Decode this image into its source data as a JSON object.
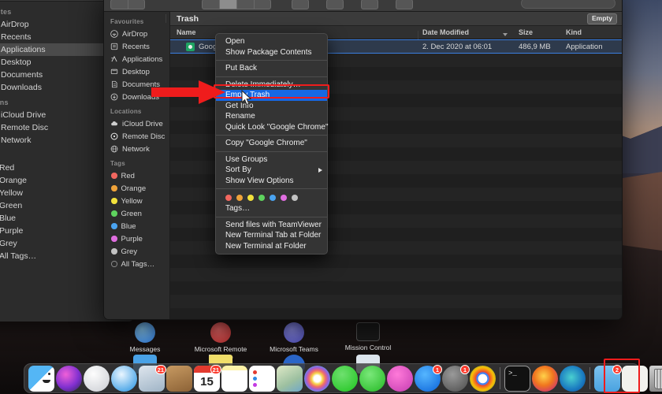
{
  "back_window": {
    "sections": [
      {
        "header": "ourites",
        "items": [
          {
            "label": "AirDrop",
            "icon": "airdrop-icon",
            "selected": false
          },
          {
            "label": "Recents",
            "icon": "recents-icon",
            "selected": false
          },
          {
            "label": "Applications",
            "icon": "applications-icon",
            "selected": true
          },
          {
            "label": "Desktop",
            "icon": "desktop-icon",
            "selected": false
          },
          {
            "label": "Documents",
            "icon": "documents-icon",
            "selected": false
          },
          {
            "label": "Downloads",
            "icon": "downloads-icon",
            "selected": false
          }
        ]
      },
      {
        "header": "ations",
        "items": [
          {
            "label": "iCloud Drive",
            "icon": "icloud-icon",
            "selected": false
          },
          {
            "label": "Remote Disc",
            "icon": "disc-icon",
            "selected": false
          },
          {
            "label": "Network",
            "icon": "network-icon",
            "selected": false
          }
        ]
      },
      {
        "header": "s",
        "items": [
          {
            "label": "Red",
            "icon": "tag-dot-icon",
            "color": "#f2675f"
          },
          {
            "label": "Orange",
            "icon": "tag-dot-icon",
            "color": "#f0a33a"
          },
          {
            "label": "Yellow",
            "icon": "tag-dot-icon",
            "color": "#f2e13c"
          },
          {
            "label": "Green",
            "icon": "tag-dot-icon",
            "color": "#5ed35e"
          },
          {
            "label": "Blue",
            "icon": "tag-dot-icon",
            "color": "#4aa3f0"
          },
          {
            "label": "Purple",
            "icon": "tag-dot-icon",
            "color": "#e06ee0"
          },
          {
            "label": "Grey",
            "icon": "tag-dot-icon",
            "color": "#c3c3c3"
          },
          {
            "label": "All Tags…",
            "icon": "all-tags-icon",
            "color": "#8a8a8a"
          }
        ]
      }
    ]
  },
  "front_window": {
    "title": "Trash",
    "empty_button": "Empty",
    "sidebar": {
      "sections": [
        {
          "header": "Favourites",
          "items": [
            {
              "label": "AirDrop",
              "icon": "airdrop-icon"
            },
            {
              "label": "Recents",
              "icon": "recents-icon"
            },
            {
              "label": "Applications",
              "icon": "applications-icon"
            },
            {
              "label": "Desktop",
              "icon": "desktop-icon"
            },
            {
              "label": "Documents",
              "icon": "documents-icon"
            },
            {
              "label": "Downloads",
              "icon": "downloads-icon"
            }
          ]
        },
        {
          "header": "Locations",
          "items": [
            {
              "label": "iCloud Drive",
              "icon": "icloud-icon"
            },
            {
              "label": "Remote Disc",
              "icon": "disc-icon"
            },
            {
              "label": "Network",
              "icon": "network-icon"
            }
          ]
        },
        {
          "header": "Tags",
          "items": [
            {
              "label": "Red",
              "icon": "tag-dot-icon",
              "color": "#f2675f"
            },
            {
              "label": "Orange",
              "icon": "tag-dot-icon",
              "color": "#f0a33a"
            },
            {
              "label": "Yellow",
              "icon": "tag-dot-icon",
              "color": "#f2e13c"
            },
            {
              "label": "Green",
              "icon": "tag-dot-icon",
              "color": "#5ed35e"
            },
            {
              "label": "Blue",
              "icon": "tag-dot-icon",
              "color": "#4aa3f0"
            },
            {
              "label": "Purple",
              "icon": "tag-dot-icon",
              "color": "#e06ee0"
            },
            {
              "label": "Grey",
              "icon": "tag-dot-icon",
              "color": "#c3c3c3"
            },
            {
              "label": "All Tags…",
              "icon": "all-tags-icon",
              "color": "#8a8a8a"
            }
          ]
        }
      ]
    },
    "columns": [
      "Name",
      "Date Modified",
      "Size",
      "Kind"
    ],
    "sort_column": "Date Modified",
    "rows": [
      {
        "name": "Google",
        "date": "2. Dec 2020 at 06:01",
        "size": "486,9 MB",
        "kind": "Application",
        "icon": "chrome-app-icon",
        "selected": true
      }
    ]
  },
  "context_menu": {
    "groups": [
      {
        "items": [
          {
            "label": "Open"
          },
          {
            "label": "Show Package Contents"
          }
        ]
      },
      {
        "items": [
          {
            "label": "Put Back"
          }
        ]
      },
      {
        "items": [
          {
            "label": "Delete Immediately…"
          },
          {
            "label": "Empty Trash",
            "highlighted": true
          },
          {
            "label": "Get Info"
          },
          {
            "label": "Rename"
          },
          {
            "label": "Quick Look \"Google Chrome\""
          }
        ]
      },
      {
        "items": [
          {
            "label": "Copy \"Google Chrome\""
          }
        ]
      },
      {
        "items": [
          {
            "label": "Use Groups"
          },
          {
            "label": "Sort By",
            "submenu": true
          },
          {
            "label": "Show View Options"
          }
        ]
      },
      {
        "tags": [
          "#f2675f",
          "#f0a33a",
          "#f2e13c",
          "#5ed35e",
          "#4aa3f0",
          "#e06ee0",
          "#c3c3c3"
        ],
        "items": [
          {
            "label": "Tags…"
          }
        ]
      },
      {
        "items": [
          {
            "label": "Send files with TeamViewer"
          },
          {
            "label": "New Terminal Tab at Folder"
          },
          {
            "label": "New Terminal at Folder"
          }
        ]
      }
    ]
  },
  "annotations": {
    "arrow_color": "#ef1c1c",
    "box_color": "#ef1c1c",
    "highlight_color": "#1668e3"
  },
  "launchpad": [
    {
      "label": "Messages",
      "icon": "messages-icon"
    },
    {
      "label": "Microsoft Remote Desktop",
      "icon": "remote-desktop-icon"
    },
    {
      "label": "Microsoft Teams",
      "icon": "teams-icon"
    },
    {
      "label": "Mission Control",
      "icon": "mission-control-icon"
    }
  ],
  "dock": {
    "items": [
      {
        "name": "finder-icon",
        "label": "Finder"
      },
      {
        "name": "siri-icon",
        "label": "Siri"
      },
      {
        "name": "launchpad-icon",
        "label": "Launchpad"
      },
      {
        "name": "safari-icon",
        "label": "Safari"
      },
      {
        "name": "mail-icon",
        "label": "Mail",
        "badge": "21"
      },
      {
        "name": "contacts-icon",
        "label": "Contacts"
      },
      {
        "name": "calendar-icon",
        "label": "Calendar",
        "day": "15",
        "badge": "21"
      },
      {
        "name": "notes-icon",
        "label": "Notes"
      },
      {
        "name": "reminders-icon",
        "label": "Reminders"
      },
      {
        "name": "maps-icon",
        "label": "Maps"
      },
      {
        "name": "photos-icon",
        "label": "Photos"
      },
      {
        "name": "messages-icon",
        "label": "Messages"
      },
      {
        "name": "facetime-icon",
        "label": "FaceTime"
      },
      {
        "name": "itunes-icon",
        "label": "iTunes"
      },
      {
        "name": "app-store-icon",
        "label": "App Store",
        "badge": "1"
      },
      {
        "name": "system-preferences-icon",
        "label": "System Preferences",
        "badge": "1"
      },
      {
        "name": "chrome-icon",
        "label": "Google Chrome"
      },
      {
        "name": "separator",
        "label": ""
      },
      {
        "name": "terminal-icon",
        "label": "Terminal"
      },
      {
        "name": "firefox-icon",
        "label": "Firefox"
      },
      {
        "name": "edge-icon",
        "label": "Microsoft Edge"
      },
      {
        "name": "separator",
        "label": ""
      },
      {
        "name": "downloads-folder-icon",
        "label": "Downloads",
        "badge": "2"
      },
      {
        "name": "document-icon",
        "label": "Document"
      },
      {
        "name": "trash-icon",
        "label": "Trash",
        "highlighted": true
      }
    ]
  }
}
